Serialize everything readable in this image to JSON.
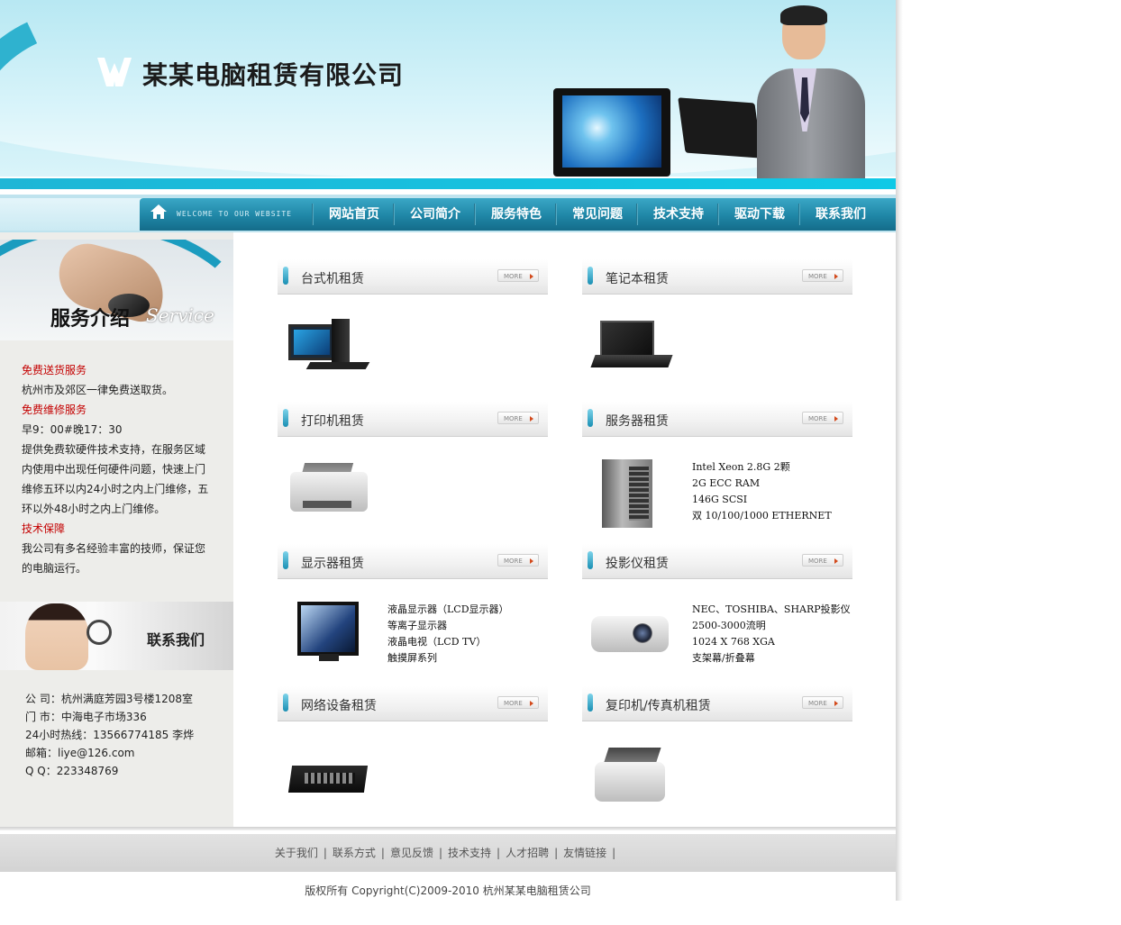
{
  "header": {
    "company_name": "某某电脑租赁有限公司",
    "accent_color": "#1fb6d6"
  },
  "nav": {
    "welcome": "WELCOME TO OUR WEBSITE",
    "items": [
      "网站首页",
      "公司简介",
      "服务特色",
      "常见问题",
      "技术支持",
      "驱动下载",
      "联系我们"
    ]
  },
  "sidebar": {
    "service_title": "服务介绍",
    "service_title_en": "Service",
    "service_sections": [
      {
        "heading": "免费送货服务",
        "lines": [
          "杭州市及郊区一律免费送取货。"
        ]
      },
      {
        "heading": "免费维修服务",
        "lines": [
          "早9：00#晚17：30",
          "提供免费软硬件技术支持，在服务区域",
          "内使用中出现任何硬件问题，快速上门",
          "维修五环以内24小时之内上门维修，五",
          "环以外48小时之内上门维修。"
        ]
      },
      {
        "heading": "技术保障",
        "lines": [
          "我公司有多名经验丰富的技师，保证您",
          "的电脑运行。"
        ]
      }
    ],
    "contact_title": "联系我们",
    "contact_lines": [
      "公 司：杭州满庭芳园3号楼1208室",
      "门 市：中海电子市场336",
      "24小时热线：13566774185 李烨",
      "邮箱：liye@126.com",
      "Q Q：223348769"
    ]
  },
  "categories": [
    {
      "title": "台式机租赁",
      "more": "MORE",
      "icon": "desktop-computer",
      "spec": []
    },
    {
      "title": "笔记本租赁",
      "more": "MORE",
      "icon": "laptop",
      "spec": []
    },
    {
      "title": "打印机租赁",
      "more": "MORE",
      "icon": "printer",
      "spec": []
    },
    {
      "title": "服务器租赁",
      "more": "MORE",
      "icon": "server",
      "spec": [
        "Intel Xeon 2.8G 2颗",
        "2G ECC RAM",
        "146G SCSI",
        "双 10/100/1000 ETHERNET"
      ]
    },
    {
      "title": "显示器租赁",
      "more": "MORE",
      "icon": "monitor",
      "spec": [
        "液晶显示器（LCD显示器）",
        "等离子显示器",
        "液晶电视（LCD TV）",
        "触摸屏系列"
      ]
    },
    {
      "title": "投影仪租赁",
      "more": "MORE",
      "icon": "projector",
      "spec": [
        "NEC、TOSHIBA、SHARP投影仪",
        "2500-3000流明",
        "1024 X 768 XGA",
        "支架幕/折叠幕"
      ]
    },
    {
      "title": "网络设备租赁",
      "more": "MORE",
      "icon": "network-switch",
      "spec": []
    },
    {
      "title": "复印机/传真机租赁",
      "more": "MORE",
      "icon": "copier",
      "spec": []
    }
  ],
  "footer": {
    "links": [
      "关于我们",
      "联系方式",
      "意见反馈",
      "技术支持",
      "人才招聘",
      "友情链接"
    ],
    "copyright": "版权所有 Copyright(C)2009-2010 杭州某某电脑租赁公司"
  }
}
